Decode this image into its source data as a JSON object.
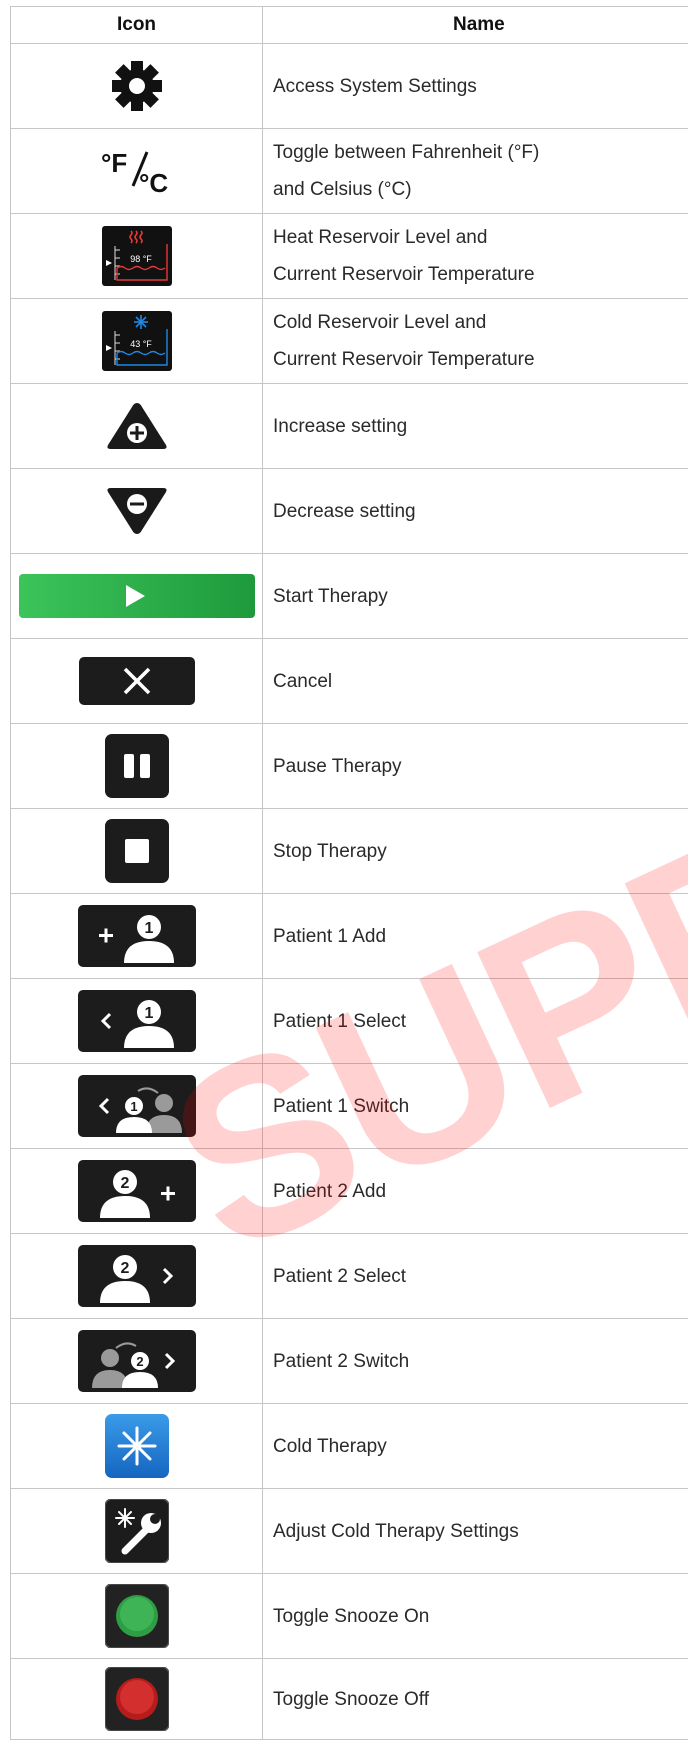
{
  "table": {
    "header_icon": "Icon",
    "header_name": "Name",
    "rows": [
      {
        "icon": "gear-icon",
        "name": "Access System Settings"
      },
      {
        "icon": "fahrenheit-celsius-icon",
        "icon_text_f": "°F",
        "icon_text_c": "°C",
        "name_line1": "Toggle between Fahrenheit (°F)",
        "name_line2": "and Celsius (°C)"
      },
      {
        "icon": "heat-reservoir-icon",
        "icon_temp": "98 °F",
        "name_line1": "Heat Reservoir Level and",
        "name_line2": "Current Reservoir Temperature"
      },
      {
        "icon": "cold-reservoir-icon",
        "icon_temp": "43 °F",
        "name_line1": "Cold Reservoir Level and",
        "name_line2": "Current Reservoir Temperature"
      },
      {
        "icon": "increase-triangle-icon",
        "name": "Increase setting"
      },
      {
        "icon": "decrease-triangle-icon",
        "name": "Decrease setting"
      },
      {
        "icon": "play-icon",
        "name": "Start Therapy"
      },
      {
        "icon": "close-icon",
        "name": "Cancel"
      },
      {
        "icon": "pause-icon",
        "name": "Pause Therapy"
      },
      {
        "icon": "stop-icon",
        "name": "Stop Therapy"
      },
      {
        "icon": "patient-1-add-icon",
        "badge": "1",
        "name": "Patient 1 Add"
      },
      {
        "icon": "patient-1-select-icon",
        "badge": "1",
        "name": "Patient 1 Select"
      },
      {
        "icon": "patient-1-switch-icon",
        "badge": "1",
        "name": "Patient 1 Switch"
      },
      {
        "icon": "patient-2-add-icon",
        "badge": "2",
        "name": "Patient 2 Add"
      },
      {
        "icon": "patient-2-select-icon",
        "badge": "2",
        "name": "Patient 2 Select"
      },
      {
        "icon": "patient-2-switch-icon",
        "badge": "2",
        "name": "Patient 2 Switch"
      },
      {
        "icon": "snowflake-icon",
        "name": "Cold Therapy"
      },
      {
        "icon": "snowflake-wrench-icon",
        "name": "Adjust Cold Therapy Settings"
      },
      {
        "icon": "green-circle-icon",
        "name": "Toggle Snooze On"
      },
      {
        "icon": "red-circle-icon",
        "name": "Toggle Snooze Off"
      }
    ]
  },
  "watermark": "SUPER",
  "colors": {
    "start_green": "#2db04a",
    "heat_red": "#e53935",
    "cold_blue": "#1e88e5",
    "watermark": "#ff0000"
  }
}
